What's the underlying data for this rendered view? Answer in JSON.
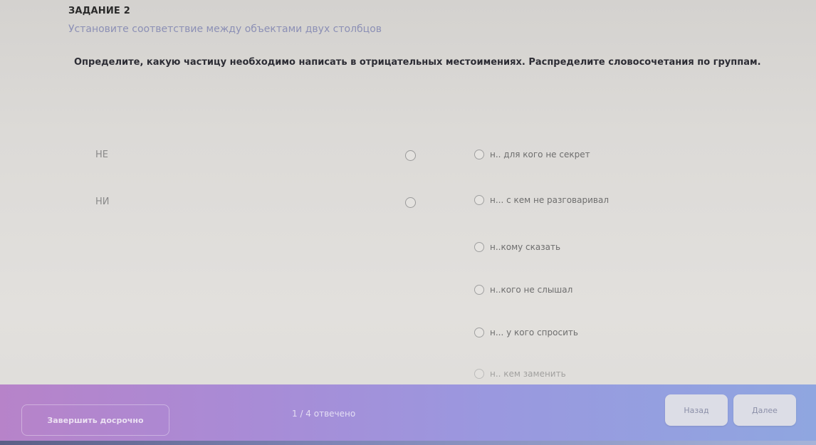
{
  "task": {
    "label": "ЗАДАНИЕ 2",
    "subtitle": "Установите соответствие между объектами двух столбцов",
    "instruction": "Определите, какую частицу необходимо написать в отрицательных местоимениях. Распределите словосочетания по группам."
  },
  "groups": [
    {
      "label": "НЕ"
    },
    {
      "label": "НИ"
    }
  ],
  "options": [
    {
      "text": "н.. для кого не секрет"
    },
    {
      "text": "н... с кем не разговаривал"
    },
    {
      "text": "н..кому сказать"
    },
    {
      "text": "н..кого не слышал"
    },
    {
      "text": "н... у кого спросить"
    },
    {
      "text": "н.. кем заменить"
    }
  ],
  "footer": {
    "finish_label": "Завершить досрочно",
    "progress": "1 / 4 отвечено",
    "back_label": "Назад",
    "next_label": "Далее"
  },
  "colors": {
    "footer_gradient_start": "#b783c9",
    "footer_gradient_end": "#8fa6e0",
    "subtitle": "#8c90b5"
  }
}
